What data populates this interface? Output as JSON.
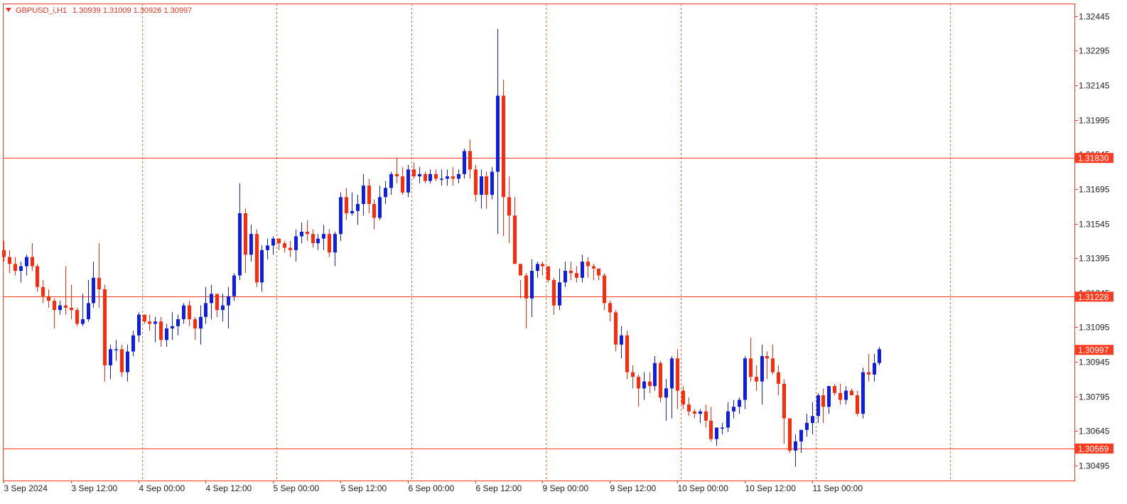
{
  "header": {
    "symbol": "GBPUSD_i,H1",
    "ohlc_text": "1.30939 1.31009 1.30926 1.30997"
  },
  "colors": {
    "bull": "#0f1ee6",
    "bear": "#ff2a0a",
    "accent": "#ff3b1f",
    "grid": "#f06a3a",
    "background": "#ffffff"
  },
  "chart_data": {
    "type": "candlestick",
    "symbol": "GBPUSD_i",
    "timeframe": "H1",
    "ylim": [
      1.3043,
      1.325
    ],
    "yticks": [
      "1.30495",
      "1.30645",
      "1.30795",
      "1.30945",
      "1.31095",
      "1.31245",
      "1.31395",
      "1.31545",
      "1.31695",
      "1.31845",
      "1.31995",
      "1.32145",
      "1.32295",
      "1.32445"
    ],
    "xticks": [
      {
        "label": "3 Sep 2024",
        "index": 0
      },
      {
        "label": "3 Sep 12:00",
        "index": 12
      },
      {
        "label": "4 Sep 00:00",
        "index": 24
      },
      {
        "label": "4 Sep 12:00",
        "index": 36
      },
      {
        "label": "5 Sep 00:00",
        "index": 48
      },
      {
        "label": "5 Sep 12:00",
        "index": 60
      },
      {
        "label": "6 Sep 00:00",
        "index": 72
      },
      {
        "label": "6 Sep 12:00",
        "index": 84
      },
      {
        "label": "9 Sep 00:00",
        "index": 96
      },
      {
        "label": "9 Sep 12:00",
        "index": 108
      },
      {
        "label": "10 Sep 00:00",
        "index": 120
      },
      {
        "label": "10 Sep 12:00",
        "index": 132
      },
      {
        "label": "11 Sep 00:00",
        "index": 144
      }
    ],
    "vertical_separators": [
      24,
      48,
      72,
      96,
      120,
      144,
      168
    ],
    "horizontal_levels": [
      {
        "value": 1.3183,
        "label": "1.31830"
      },
      {
        "value": 1.31228,
        "label": "1.31228"
      },
      {
        "value": 1.30569,
        "label": "1.30569"
      }
    ],
    "current_price": {
      "value": 1.30997,
      "label": "1.30997"
    },
    "candles": [
      [
        1.3143,
        1.3147,
        1.3138,
        1.314
      ],
      [
        1.314,
        1.3143,
        1.3133,
        1.3137
      ],
      [
        1.3137,
        1.314,
        1.3132,
        1.3134
      ],
      [
        1.3134,
        1.3138,
        1.3129,
        1.3136
      ],
      [
        1.3136,
        1.3141,
        1.3132,
        1.314
      ],
      [
        1.314,
        1.3146,
        1.3134,
        1.3136
      ],
      [
        1.3136,
        1.3137,
        1.3125,
        1.3127
      ],
      [
        1.3127,
        1.313,
        1.312,
        1.3123
      ],
      [
        1.3123,
        1.3126,
        1.3118,
        1.3121
      ],
      [
        1.3121,
        1.3122,
        1.3109,
        1.3117
      ],
      [
        1.3117,
        1.3121,
        1.3115,
        1.3119
      ],
      [
        1.3119,
        1.3136,
        1.3115,
        1.3118
      ],
      [
        1.3118,
        1.3128,
        1.3113,
        1.3117
      ],
      [
        1.3117,
        1.3118,
        1.311,
        1.3111
      ],
      [
        1.3111,
        1.3124,
        1.311,
        1.3113
      ],
      [
        1.3113,
        1.313,
        1.3112,
        1.312
      ],
      [
        1.312,
        1.3138,
        1.3118,
        1.3131
      ],
      [
        1.3131,
        1.3146,
        1.3118,
        1.3126
      ],
      [
        1.3126,
        1.3128,
        1.3086,
        1.3093
      ],
      [
        1.3093,
        1.3102,
        1.3087,
        1.31
      ],
      [
        1.31,
        1.3104,
        1.3095,
        1.31
      ],
      [
        1.31,
        1.3102,
        1.3088,
        1.309
      ],
      [
        1.309,
        1.3102,
        1.3086,
        1.3099
      ],
      [
        1.3099,
        1.3108,
        1.3097,
        1.3106
      ],
      [
        1.3106,
        1.3116,
        1.3103,
        1.3115
      ],
      [
        1.3115,
        1.3114,
        1.3111,
        1.3112
      ],
      [
        1.3112,
        1.3115,
        1.3108,
        1.3111
      ],
      [
        1.3111,
        1.3114,
        1.3103,
        1.3112
      ],
      [
        1.3112,
        1.3114,
        1.3101,
        1.3104
      ],
      [
        1.3104,
        1.3111,
        1.3101,
        1.3109
      ],
      [
        1.3109,
        1.3116,
        1.3104,
        1.311
      ],
      [
        1.311,
        1.3115,
        1.3106,
        1.3113
      ],
      [
        1.3113,
        1.312,
        1.3111,
        1.3119
      ],
      [
        1.3119,
        1.3121,
        1.311,
        1.3113
      ],
      [
        1.3113,
        1.3114,
        1.3104,
        1.3109
      ],
      [
        1.3109,
        1.3119,
        1.3102,
        1.3114
      ],
      [
        1.3114,
        1.3127,
        1.3111,
        1.312
      ],
      [
        1.312,
        1.3128,
        1.3113,
        1.3124
      ],
      [
        1.3124,
        1.3122,
        1.3114,
        1.3117
      ],
      [
        1.3117,
        1.3124,
        1.3112,
        1.3119
      ],
      [
        1.3119,
        1.3127,
        1.3109,
        1.3123
      ],
      [
        1.3123,
        1.3133,
        1.3121,
        1.3132
      ],
      [
        1.3132,
        1.3172,
        1.313,
        1.3159
      ],
      [
        1.3159,
        1.3161,
        1.3133,
        1.3141
      ],
      [
        1.3141,
        1.3154,
        1.3138,
        1.315
      ],
      [
        1.315,
        1.3152,
        1.3127,
        1.3129
      ],
      [
        1.3129,
        1.3145,
        1.3125,
        1.3143
      ],
      [
        1.3143,
        1.3148,
        1.3139,
        1.3145
      ],
      [
        1.3145,
        1.3149,
        1.3141,
        1.3148
      ],
      [
        1.3148,
        1.3148,
        1.3143,
        1.3146
      ],
      [
        1.3146,
        1.3147,
        1.3142,
        1.3144
      ],
      [
        1.3144,
        1.3147,
        1.314,
        1.3143
      ],
      [
        1.3143,
        1.3152,
        1.3138,
        1.3149
      ],
      [
        1.3149,
        1.3155,
        1.3146,
        1.3151
      ],
      [
        1.3151,
        1.3156,
        1.3147,
        1.315
      ],
      [
        1.315,
        1.3152,
        1.3144,
        1.3146
      ],
      [
        1.3146,
        1.315,
        1.3143,
        1.3148
      ],
      [
        1.3148,
        1.3154,
        1.3143,
        1.315
      ],
      [
        1.315,
        1.3152,
        1.314,
        1.3142
      ],
      [
        1.3142,
        1.3151,
        1.3136,
        1.315
      ],
      [
        1.315,
        1.3168,
        1.3147,
        1.3166
      ],
      [
        1.3166,
        1.317,
        1.3156,
        1.3159
      ],
      [
        1.3159,
        1.3168,
        1.3158,
        1.316
      ],
      [
        1.316,
        1.3167,
        1.3154,
        1.3163
      ],
      [
        1.3163,
        1.3176,
        1.3158,
        1.3171
      ],
      [
        1.3171,
        1.3174,
        1.3159,
        1.3163
      ],
      [
        1.3163,
        1.3165,
        1.3152,
        1.3157
      ],
      [
        1.3157,
        1.3171,
        1.3156,
        1.3166
      ],
      [
        1.3166,
        1.3173,
        1.3163,
        1.317
      ],
      [
        1.317,
        1.3177,
        1.3167,
        1.3176
      ],
      [
        1.3176,
        1.3183,
        1.3172,
        1.3175
      ],
      [
        1.3175,
        1.3179,
        1.3167,
        1.3168
      ],
      [
        1.3168,
        1.318,
        1.3166,
        1.3178
      ],
      [
        1.3178,
        1.3181,
        1.3174,
        1.3175
      ],
      [
        1.3175,
        1.3179,
        1.3172,
        1.3176
      ],
      [
        1.3176,
        1.3177,
        1.3172,
        1.3173
      ],
      [
        1.3173,
        1.3178,
        1.3172,
        1.3176
      ],
      [
        1.3176,
        1.3178,
        1.3173,
        1.3174
      ],
      [
        1.3174,
        1.3178,
        1.3171,
        1.3174
      ],
      [
        1.3174,
        1.3178,
        1.3171,
        1.3175
      ],
      [
        1.3175,
        1.3179,
        1.3171,
        1.3174
      ],
      [
        1.3174,
        1.3178,
        1.3172,
        1.3176
      ],
      [
        1.3176,
        1.3187,
        1.3174,
        1.3186
      ],
      [
        1.3186,
        1.3191,
        1.3174,
        1.3178
      ],
      [
        1.3178,
        1.318,
        1.3164,
        1.3167
      ],
      [
        1.3167,
        1.3178,
        1.3161,
        1.3175
      ],
      [
        1.3175,
        1.3177,
        1.3161,
        1.3167
      ],
      [
        1.3167,
        1.3179,
        1.3165,
        1.3177
      ],
      [
        1.3177,
        1.3239,
        1.315,
        1.321
      ],
      [
        1.321,
        1.3217,
        1.3149,
        1.3166
      ],
      [
        1.3166,
        1.3175,
        1.3146,
        1.3158
      ],
      [
        1.3158,
        1.3166,
        1.3137,
        1.3137
      ],
      [
        1.3137,
        1.313,
        1.3122,
        1.3132
      ],
      [
        1.3132,
        1.3133,
        1.3109,
        1.3122
      ],
      [
        1.3122,
        1.3139,
        1.3114,
        1.3134
      ],
      [
        1.3134,
        1.3138,
        1.3131,
        1.3137
      ],
      [
        1.3137,
        1.3138,
        1.3132,
        1.3136
      ],
      [
        1.3136,
        1.3134,
        1.3129,
        1.313
      ],
      [
        1.313,
        1.3131,
        1.3115,
        1.3119
      ],
      [
        1.3119,
        1.3135,
        1.3117,
        1.3129
      ],
      [
        1.3129,
        1.3138,
        1.3127,
        1.3134
      ],
      [
        1.3134,
        1.3138,
        1.313,
        1.3133
      ],
      [
        1.3133,
        1.3136,
        1.3129,
        1.3131
      ],
      [
        1.3131,
        1.3141,
        1.3129,
        1.3138
      ],
      [
        1.3138,
        1.314,
        1.3131,
        1.3136
      ],
      [
        1.3136,
        1.3137,
        1.313,
        1.3135
      ],
      [
        1.3135,
        1.3135,
        1.313,
        1.3132
      ],
      [
        1.3132,
        1.3133,
        1.3117,
        1.312
      ],
      [
        1.312,
        1.3121,
        1.3112,
        1.3116
      ],
      [
        1.3116,
        1.3117,
        1.3099,
        1.3102
      ],
      [
        1.3102,
        1.311,
        1.3096,
        1.3106
      ],
      [
        1.3106,
        1.3108,
        1.3087,
        1.309
      ],
      [
        1.309,
        1.3093,
        1.3083,
        1.3088
      ],
      [
        1.3088,
        1.3089,
        1.3075,
        1.3083
      ],
      [
        1.3083,
        1.309,
        1.3078,
        1.3086
      ],
      [
        1.3086,
        1.309,
        1.3081,
        1.3084
      ],
      [
        1.3084,
        1.3097,
        1.3082,
        1.3094
      ],
      [
        1.3094,
        1.3095,
        1.3077,
        1.3079
      ],
      [
        1.3079,
        1.3087,
        1.3069,
        1.3083
      ],
      [
        1.3083,
        1.3097,
        1.307,
        1.3096
      ],
      [
        1.3096,
        1.31,
        1.3074,
        1.3082
      ],
      [
        1.3082,
        1.3084,
        1.3074,
        1.3076
      ],
      [
        1.3076,
        1.3079,
        1.3071,
        1.3073
      ],
      [
        1.3073,
        1.3074,
        1.307,
        1.3072
      ],
      [
        1.3072,
        1.3074,
        1.3068,
        1.3073
      ],
      [
        1.3073,
        1.3076,
        1.3066,
        1.3069
      ],
      [
        1.3069,
        1.3075,
        1.306,
        1.3061
      ],
      [
        1.3061,
        1.3066,
        1.3058,
        1.3066
      ],
      [
        1.3066,
        1.3068,
        1.3063,
        1.3066
      ],
      [
        1.3066,
        1.3077,
        1.3064,
        1.3073
      ],
      [
        1.3073,
        1.3078,
        1.307,
        1.3075
      ],
      [
        1.3075,
        1.3079,
        1.3072,
        1.3078
      ],
      [
        1.3078,
        1.3097,
        1.3074,
        1.3096
      ],
      [
        1.3096,
        1.3105,
        1.3086,
        1.3088
      ],
      [
        1.3088,
        1.3093,
        1.3082,
        1.3086
      ],
      [
        1.3086,
        1.3102,
        1.3076,
        1.3097
      ],
      [
        1.3097,
        1.3099,
        1.3087,
        1.3096
      ],
      [
        1.3096,
        1.3102,
        1.3089,
        1.309
      ],
      [
        1.309,
        1.3093,
        1.308,
        1.3085
      ],
      [
        1.3085,
        1.3087,
        1.3059,
        1.307
      ],
      [
        1.307,
        1.3068,
        1.3055,
        1.3056
      ],
      [
        1.3056,
        1.3063,
        1.3049,
        1.306
      ],
      [
        1.306,
        1.3062,
        1.3055,
        1.3065
      ],
      [
        1.3065,
        1.3072,
        1.3062,
        1.3068
      ],
      [
        1.3068,
        1.3077,
        1.3063,
        1.3071
      ],
      [
        1.3071,
        1.3081,
        1.3068,
        1.308
      ],
      [
        1.308,
        1.3083,
        1.3068,
        1.3075
      ],
      [
        1.3075,
        1.3084,
        1.3072,
        1.3084
      ],
      [
        1.3084,
        1.3085,
        1.308,
        1.3081
      ],
      [
        1.3081,
        1.3085,
        1.3076,
        1.3078
      ],
      [
        1.3078,
        1.3084,
        1.3076,
        1.3082
      ],
      [
        1.3082,
        1.3083,
        1.3081,
        1.308
      ],
      [
        1.308,
        1.3082,
        1.3071,
        1.3072
      ],
      [
        1.3072,
        1.3092,
        1.307,
        1.309
      ],
      [
        1.309,
        1.3098,
        1.3086,
        1.3089
      ],
      [
        1.3089,
        1.3098,
        1.3086,
        1.3094
      ],
      [
        1.3094,
        1.3101,
        1.3093,
        1.31
      ]
    ]
  }
}
